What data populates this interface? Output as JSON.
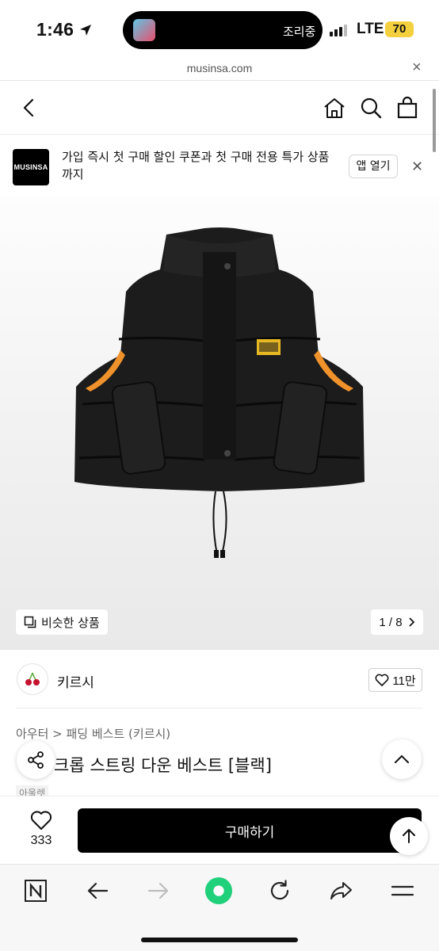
{
  "status_bar": {
    "time": "1:46",
    "now_playing": "조리중",
    "network": "LTE",
    "battery": "70"
  },
  "browser": {
    "url": "musinsa.com"
  },
  "app_banner": {
    "logo_text": "MUSINSA",
    "message": "가입 즉시 첫 구매 할인 쿠폰과 첫 구매 전용 특가 상품까지",
    "open_app_label": "앱 열기"
  },
  "gallery": {
    "similar_label": "비슷한 상품",
    "pager": "1 / 8"
  },
  "brand": {
    "name": "키르시",
    "like_count": "11만"
  },
  "product": {
    "breadcrumb": "아우터 > 패딩 베스트 (키르시)",
    "title": "크롭 스트링 다운 베스트 [블랙]",
    "tag": "아울렛"
  },
  "purchase": {
    "wish_count": "333",
    "buy_label": "구매하기"
  },
  "colors": {
    "accent": "#000000",
    "battery": "#f4d03f",
    "toolbar_green": "#21d07a",
    "vest_trim": "#f0922b"
  }
}
